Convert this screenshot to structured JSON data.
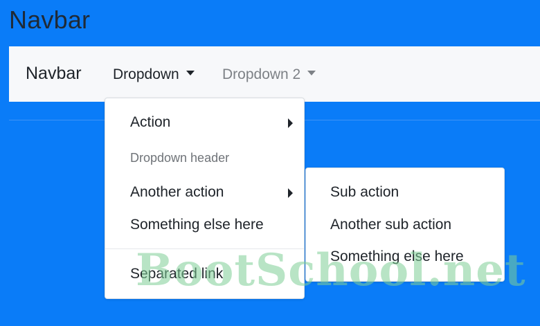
{
  "page": {
    "title": "Navbar"
  },
  "navbar": {
    "brand": "Navbar",
    "dropdown1": "Dropdown",
    "dropdown2": "Dropdown 2"
  },
  "main_menu": {
    "action": "Action",
    "header": "Dropdown header",
    "another_action": "Another action",
    "something_else": "Something else here",
    "separated_link": "Separated link"
  },
  "sub_menu": {
    "sub_action": "Sub action",
    "another_sub_action": "Another sub action",
    "something_else": "Something else here"
  },
  "watermark": "BootSchool.net",
  "colors": {
    "background": "#0a7cf8",
    "navbar": "#f7f8fa",
    "text": "#1e2329",
    "muted": "#7d8186"
  },
  "icons": [
    "caret-down-icon",
    "caret-right-icon"
  ]
}
